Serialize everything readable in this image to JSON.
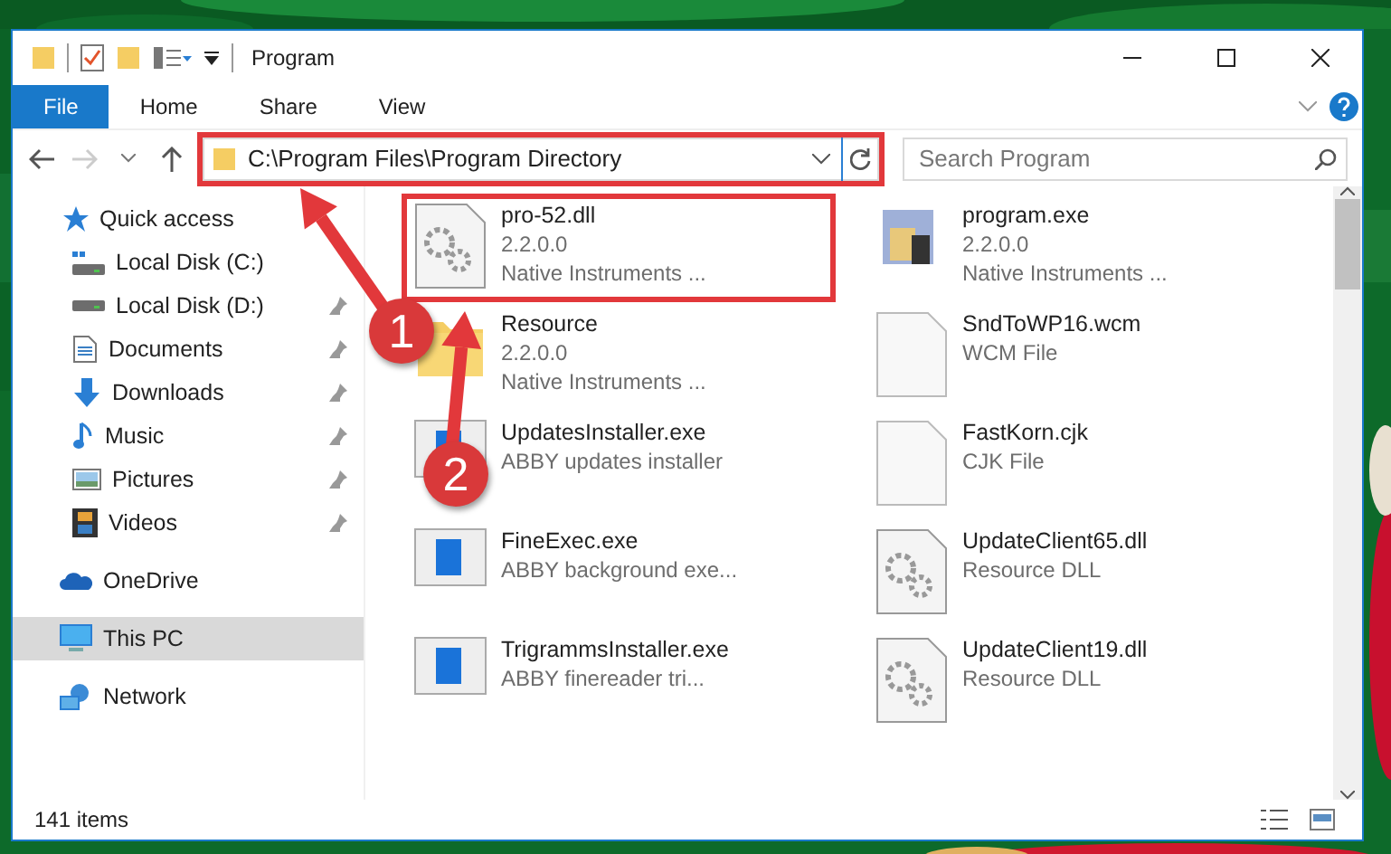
{
  "window": {
    "title": "Program"
  },
  "ribbon": {
    "tabs": [
      {
        "label": "File",
        "kind": "file"
      },
      {
        "label": "Home",
        "kind": "tab"
      },
      {
        "label": "Share",
        "kind": "tab"
      },
      {
        "label": "View",
        "kind": "tab"
      }
    ]
  },
  "address_bar": {
    "path": "C:\\Program Files\\Program Directory",
    "back_enabled": true,
    "forward_enabled": false,
    "highlighted": true
  },
  "search": {
    "placeholder": "Search Program"
  },
  "sidebar": {
    "items": [
      {
        "label": "Quick access",
        "kind": "star",
        "selected": false,
        "children": [
          {
            "label": "Local Disk (C:)",
            "kind": "windrive",
            "pinned": false,
            "selected": false
          },
          {
            "label": "Local Disk (D:)",
            "kind": "drive",
            "pinned": true,
            "selected": false
          },
          {
            "label": "Documents",
            "kind": "doc",
            "pinned": true,
            "selected": false
          },
          {
            "label": "Downloads",
            "kind": "download",
            "pinned": true,
            "selected": false
          },
          {
            "label": "Music",
            "kind": "music",
            "pinned": true,
            "selected": false
          },
          {
            "label": "Pictures",
            "kind": "pictures",
            "pinned": true,
            "selected": false
          },
          {
            "label": "Videos",
            "kind": "video",
            "pinned": true,
            "selected": false
          }
        ]
      },
      {
        "label": "OneDrive",
        "kind": "cloud",
        "selected": false
      },
      {
        "label": "This PC",
        "kind": "pc",
        "selected": true
      },
      {
        "label": "Network",
        "kind": "network",
        "selected": false
      }
    ]
  },
  "files": [
    {
      "name": "pro-52.dll",
      "details": [
        "2.2.0.0",
        "Native Instruments ..."
      ],
      "kind": "dll",
      "highlighted": true
    },
    {
      "name": "program.exe",
      "details": [
        "2.2.0.0",
        "Native Instruments ..."
      ],
      "kind": "app",
      "highlighted": false
    },
    {
      "name": "Resource",
      "details": [
        "2.2.0.0",
        "Native Instruments ..."
      ],
      "kind": "folder",
      "highlighted": false
    },
    {
      "name": "SndToWP16.wcm",
      "details": [
        "WCM File"
      ],
      "kind": "blank",
      "highlighted": false
    },
    {
      "name": "UpdatesInstaller.exe",
      "details": [
        "ABBY updates installer"
      ],
      "kind": "exe",
      "highlighted": false
    },
    {
      "name": "FastKorn.cjk",
      "details": [
        "CJK File"
      ],
      "kind": "blank",
      "highlighted": false
    },
    {
      "name": "FineExec.exe",
      "details": [
        "ABBY background exe..."
      ],
      "kind": "exe",
      "highlighted": false
    },
    {
      "name": "UpdateClient65.dll",
      "details": [
        "Resource DLL"
      ],
      "kind": "dll",
      "highlighted": false
    },
    {
      "name": "TrigrammsInstaller.exe",
      "details": [
        "ABBY finereader tri..."
      ],
      "kind": "exe",
      "highlighted": false
    },
    {
      "name": "UpdateClient19.dll",
      "details": [
        "Resource DLL"
      ],
      "kind": "dll",
      "highlighted": false
    }
  ],
  "status_bar": {
    "count": "141 items"
  },
  "annotations": [
    {
      "label": "1"
    },
    {
      "label": "2"
    }
  ]
}
